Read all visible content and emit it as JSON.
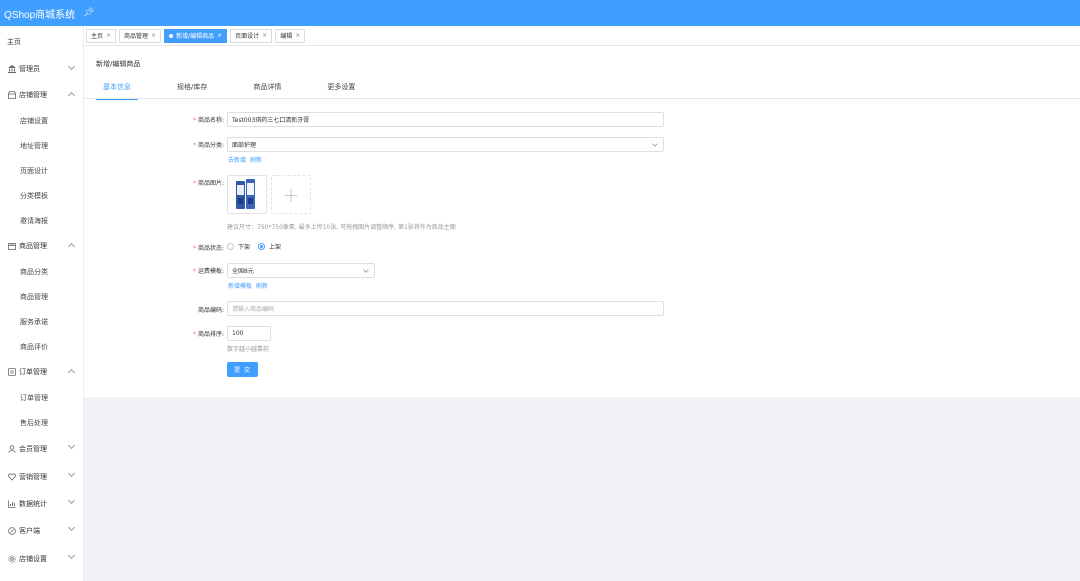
{
  "app": {
    "title": "QShop商城系统"
  },
  "sidebar": {
    "home": "主页",
    "groups": [
      {
        "label": "管理员",
        "icon": "bank-icon",
        "expanded": false,
        "items": []
      },
      {
        "label": "店铺管理",
        "icon": "store-icon",
        "expanded": true,
        "items": [
          "店铺设置",
          "地址管理",
          "页面设计",
          "分类模板",
          "邀请海报"
        ]
      },
      {
        "label": "商品管理",
        "icon": "goods-icon",
        "expanded": true,
        "items": [
          "商品分类",
          "商品管理",
          "服务承诺",
          "商品评价"
        ]
      },
      {
        "label": "订单管理",
        "icon": "order-icon",
        "expanded": true,
        "items": [
          "订单管理",
          "售后处理"
        ]
      },
      {
        "label": "会员管理",
        "icon": "user-icon",
        "expanded": false,
        "items": []
      },
      {
        "label": "营销管理",
        "icon": "heart-icon",
        "expanded": false,
        "items": []
      },
      {
        "label": "数据统计",
        "icon": "chart-icon",
        "expanded": false,
        "items": []
      },
      {
        "label": "客户端",
        "icon": "compass-icon",
        "expanded": false,
        "items": []
      },
      {
        "label": "店铺设置",
        "icon": "gear-icon",
        "expanded": false,
        "items": []
      }
    ]
  },
  "tabs": [
    {
      "label": "主页",
      "active": false
    },
    {
      "label": "商品管理",
      "active": false
    },
    {
      "label": "新增/编辑商品",
      "active": true
    },
    {
      "label": "页面设计",
      "active": false
    },
    {
      "label": "编辑",
      "active": false
    }
  ],
  "page": {
    "title": "新增/编辑商品",
    "subtabs": [
      "基本信息",
      "规格/库存",
      "商品详情",
      "更多设置"
    ]
  },
  "form": {
    "name_label": "商品名称:",
    "name_value": "Test003琪药三七口清新牙膏",
    "category_label": "商品分类:",
    "category_value": "面部护理",
    "category_links": [
      "去新增",
      "刷新"
    ],
    "image_label": "商品图片:",
    "image_hint": "建议尺寸：750*750像素, 最多上传10张, 可拖拽图片调整顺序, 第1张将作为商品主图",
    "status_label": "商品状态:",
    "status_options": [
      "下架",
      "上架"
    ],
    "status_selected": "上架",
    "freight_label": "运费模板:",
    "freight_value": "全国8元",
    "freight_links": [
      "新增模板",
      "刷新"
    ],
    "code_label": "商品编码:",
    "code_placeholder": "请输入商品编码",
    "sort_label": "商品排序:",
    "sort_value": "100",
    "sort_hint": "数字越小越靠前",
    "submit_label": "提 交"
  }
}
